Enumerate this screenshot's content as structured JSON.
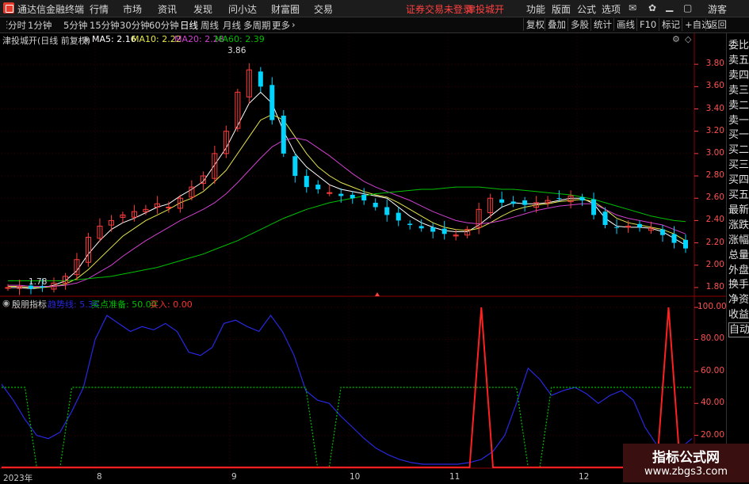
{
  "titlebar": {
    "app_name": "通达信金融终端",
    "menu": [
      "行情",
      "市场",
      "资讯",
      "发现",
      "问小达",
      "财富圈",
      "交易"
    ],
    "login_notice": "证券交易未登录",
    "stock_name": "津投城开",
    "right_menu": [
      "功能",
      "版面",
      "公式",
      "选项"
    ],
    "guest": "游客"
  },
  "toolbar": {
    "periods": [
      "分时",
      "1分钟",
      "5分钟",
      "15分钟",
      "30分钟",
      "60分钟",
      "日线",
      "周线",
      "月线",
      "多周期",
      "更多"
    ],
    "active_period": "日线",
    "right_buttons": [
      "复权",
      "叠加",
      "多股",
      "统计",
      "画线",
      "F10",
      "标记",
      "+自选",
      "返回"
    ]
  },
  "chart_header": {
    "title": "津投城开(日线 前复权)",
    "ma5": "MA5: 2.16",
    "ma10": "MA10: 2.22",
    "ma20": "MA20: 2.28",
    "ma60": "MA60: 2.39"
  },
  "indicator_header": {
    "name": "殷朋指标",
    "line1": "趋势线: 5.36",
    "line2": "买点准备: 50.00",
    "line3": "买入: 0.00"
  },
  "side_panel": [
    "委比",
    "卖五",
    "卖四",
    "卖三",
    "卖二",
    "卖一",
    "买一",
    "买二",
    "买三",
    "买四",
    "买五",
    "最新",
    "涨跌",
    "涨幅",
    "总量",
    "外盘",
    "换手",
    "净资",
    "收益",
    "自动"
  ],
  "watermark": {
    "line1": "指标公式网",
    "line2": "www.zbgs3.com"
  },
  "colors": {
    "up": "#ff3c3c",
    "down": "#00d4ff",
    "ma5": "#ffffff",
    "ma10": "#e6e64a",
    "ma20": "#d040d0",
    "ma60": "#00c000",
    "trend": "#2828e0",
    "ready": "#00c000",
    "buy": "#ff2020",
    "grid": "#8b0000"
  },
  "chart_data": [
    {
      "type": "candlestick",
      "title": "津投城开(日线 前复权)",
      "y_ticks": [
        "3.80",
        "3.60",
        "3.40",
        "3.20",
        "3.00",
        "2.80",
        "2.60",
        "2.40",
        "2.20",
        "2.00",
        "1.80"
      ],
      "ylim": [
        1.75,
        3.95
      ],
      "x_ticks": [
        "2023年",
        "8",
        "9",
        "10",
        "11",
        "12"
      ],
      "annotations": {
        "high": "3.86",
        "low": "1.78"
      },
      "series": [
        {
          "name": "MA5",
          "values": [
            1.8,
            1.8,
            1.79,
            1.8,
            1.82,
            1.86,
            1.95,
            2.1,
            2.22,
            2.32,
            2.38,
            2.42,
            2.47,
            2.52,
            2.55,
            2.62,
            2.68,
            2.75,
            2.9,
            3.05,
            3.25,
            3.45,
            3.55,
            3.45,
            3.2,
            3.0,
            2.88,
            2.8,
            2.72,
            2.68,
            2.66,
            2.64,
            2.62,
            2.6,
            2.52,
            2.44,
            2.38,
            2.34,
            2.31,
            2.3,
            2.3,
            2.36,
            2.44,
            2.52,
            2.56,
            2.55,
            2.55,
            2.56,
            2.58,
            2.6,
            2.6,
            2.55,
            2.42,
            2.35,
            2.34,
            2.34,
            2.33,
            2.3,
            2.24,
            2.18
          ]
        },
        {
          "name": "MA10",
          "values": [
            1.81,
            1.81,
            1.8,
            1.8,
            1.81,
            1.83,
            1.88,
            1.96,
            2.06,
            2.16,
            2.26,
            2.33,
            2.4,
            2.45,
            2.5,
            2.56,
            2.6,
            2.66,
            2.75,
            2.85,
            3.0,
            3.15,
            3.3,
            3.35,
            3.3,
            3.15,
            3.0,
            2.88,
            2.8,
            2.74,
            2.7,
            2.66,
            2.63,
            2.61,
            2.56,
            2.5,
            2.44,
            2.38,
            2.34,
            2.32,
            2.31,
            2.33,
            2.38,
            2.44,
            2.49,
            2.52,
            2.54,
            2.55,
            2.57,
            2.58,
            2.59,
            2.57,
            2.5,
            2.42,
            2.38,
            2.36,
            2.34,
            2.32,
            2.28,
            2.22
          ]
        },
        {
          "name": "MA20",
          "values": [
            1.82,
            1.82,
            1.81,
            1.81,
            1.81,
            1.82,
            1.84,
            1.88,
            1.94,
            2.0,
            2.08,
            2.15,
            2.22,
            2.28,
            2.34,
            2.4,
            2.45,
            2.5,
            2.56,
            2.64,
            2.74,
            2.85,
            2.96,
            3.06,
            3.12,
            3.14,
            3.12,
            3.05,
            2.98,
            2.9,
            2.82,
            2.75,
            2.7,
            2.66,
            2.62,
            2.58,
            2.53,
            2.48,
            2.44,
            2.4,
            2.38,
            2.37,
            2.38,
            2.4,
            2.43,
            2.46,
            2.49,
            2.51,
            2.53,
            2.54,
            2.55,
            2.55,
            2.5,
            2.45,
            2.42,
            2.4,
            2.38,
            2.36,
            2.32,
            2.28
          ]
        },
        {
          "name": "MA60",
          "values": [
            1.86,
            1.86,
            1.86,
            1.86,
            1.86,
            1.86,
            1.87,
            1.88,
            1.89,
            1.9,
            1.92,
            1.94,
            1.96,
            1.98,
            2.01,
            2.04,
            2.07,
            2.1,
            2.14,
            2.18,
            2.22,
            2.27,
            2.32,
            2.37,
            2.42,
            2.46,
            2.5,
            2.53,
            2.56,
            2.58,
            2.6,
            2.62,
            2.64,
            2.65,
            2.66,
            2.67,
            2.68,
            2.68,
            2.69,
            2.7,
            2.7,
            2.7,
            2.69,
            2.68,
            2.68,
            2.67,
            2.66,
            2.65,
            2.64,
            2.63,
            2.61,
            2.59,
            2.56,
            2.53,
            2.5,
            2.47,
            2.44,
            2.42,
            2.4,
            2.39
          ]
        }
      ],
      "candles_close": [
        1.8,
        1.81,
        1.79,
        1.8,
        1.84,
        1.9,
        2.05,
        2.25,
        2.35,
        2.4,
        2.45,
        2.48,
        2.5,
        2.55,
        2.52,
        2.6,
        2.7,
        2.8,
        3.0,
        3.2,
        3.55,
        3.75,
        3.6,
        3.3,
        3.0,
        2.8,
        2.7,
        2.68,
        2.65,
        2.62,
        2.6,
        2.58,
        2.52,
        2.45,
        2.4,
        2.36,
        2.33,
        2.3,
        2.28,
        2.27,
        2.32,
        2.5,
        2.6,
        2.56,
        2.55,
        2.54,
        2.56,
        2.58,
        2.6,
        2.62,
        2.58,
        2.45,
        2.36,
        2.34,
        2.35,
        2.34,
        2.33,
        2.27,
        2.2,
        2.15
      ]
    },
    {
      "type": "line",
      "title": "殷朋指标",
      "y_ticks": [
        "100.00",
        "80.00",
        "60.00",
        "40.00",
        "20.00"
      ],
      "ylim": [
        0,
        105
      ],
      "series": [
        {
          "name": "趋势线",
          "values": [
            52,
            42,
            30,
            20,
            18,
            22,
            35,
            50,
            80,
            95,
            90,
            85,
            88,
            86,
            90,
            85,
            72,
            70,
            75,
            90,
            92,
            88,
            85,
            95,
            85,
            70,
            48,
            42,
            40,
            32,
            25,
            18,
            12,
            8,
            5,
            3,
            2,
            2,
            2,
            2,
            3,
            5,
            10,
            20,
            40,
            62,
            55,
            45,
            48,
            50,
            46,
            40,
            45,
            48,
            42,
            25,
            14,
            8,
            12,
            18
          ]
        },
        {
          "name": "买点准备",
          "values": [
            50,
            50,
            50,
            0,
            0,
            0,
            50,
            50,
            50,
            50,
            50,
            50,
            50,
            50,
            50,
            50,
            50,
            50,
            50,
            50,
            50,
            50,
            50,
            50,
            50,
            50,
            50,
            0,
            0,
            50,
            50,
            50,
            50,
            50,
            50,
            50,
            50,
            50,
            50,
            50,
            50,
            50,
            50,
            50,
            50,
            0,
            0,
            50,
            50,
            50,
            50,
            50,
            50,
            50,
            50,
            50,
            50,
            50,
            50,
            50
          ]
        },
        {
          "name": "买入",
          "values": [
            0,
            0,
            0,
            0,
            0,
            0,
            0,
            0,
            0,
            0,
            0,
            0,
            0,
            0,
            0,
            0,
            0,
            0,
            0,
            0,
            0,
            0,
            0,
            0,
            0,
            0,
            0,
            0,
            0,
            0,
            0,
            0,
            0,
            0,
            0,
            0,
            0,
            0,
            0,
            0,
            0,
            100,
            0,
            0,
            0,
            0,
            0,
            0,
            0,
            0,
            0,
            0,
            0,
            0,
            0,
            0,
            0,
            100,
            0,
            0
          ]
        }
      ]
    }
  ]
}
